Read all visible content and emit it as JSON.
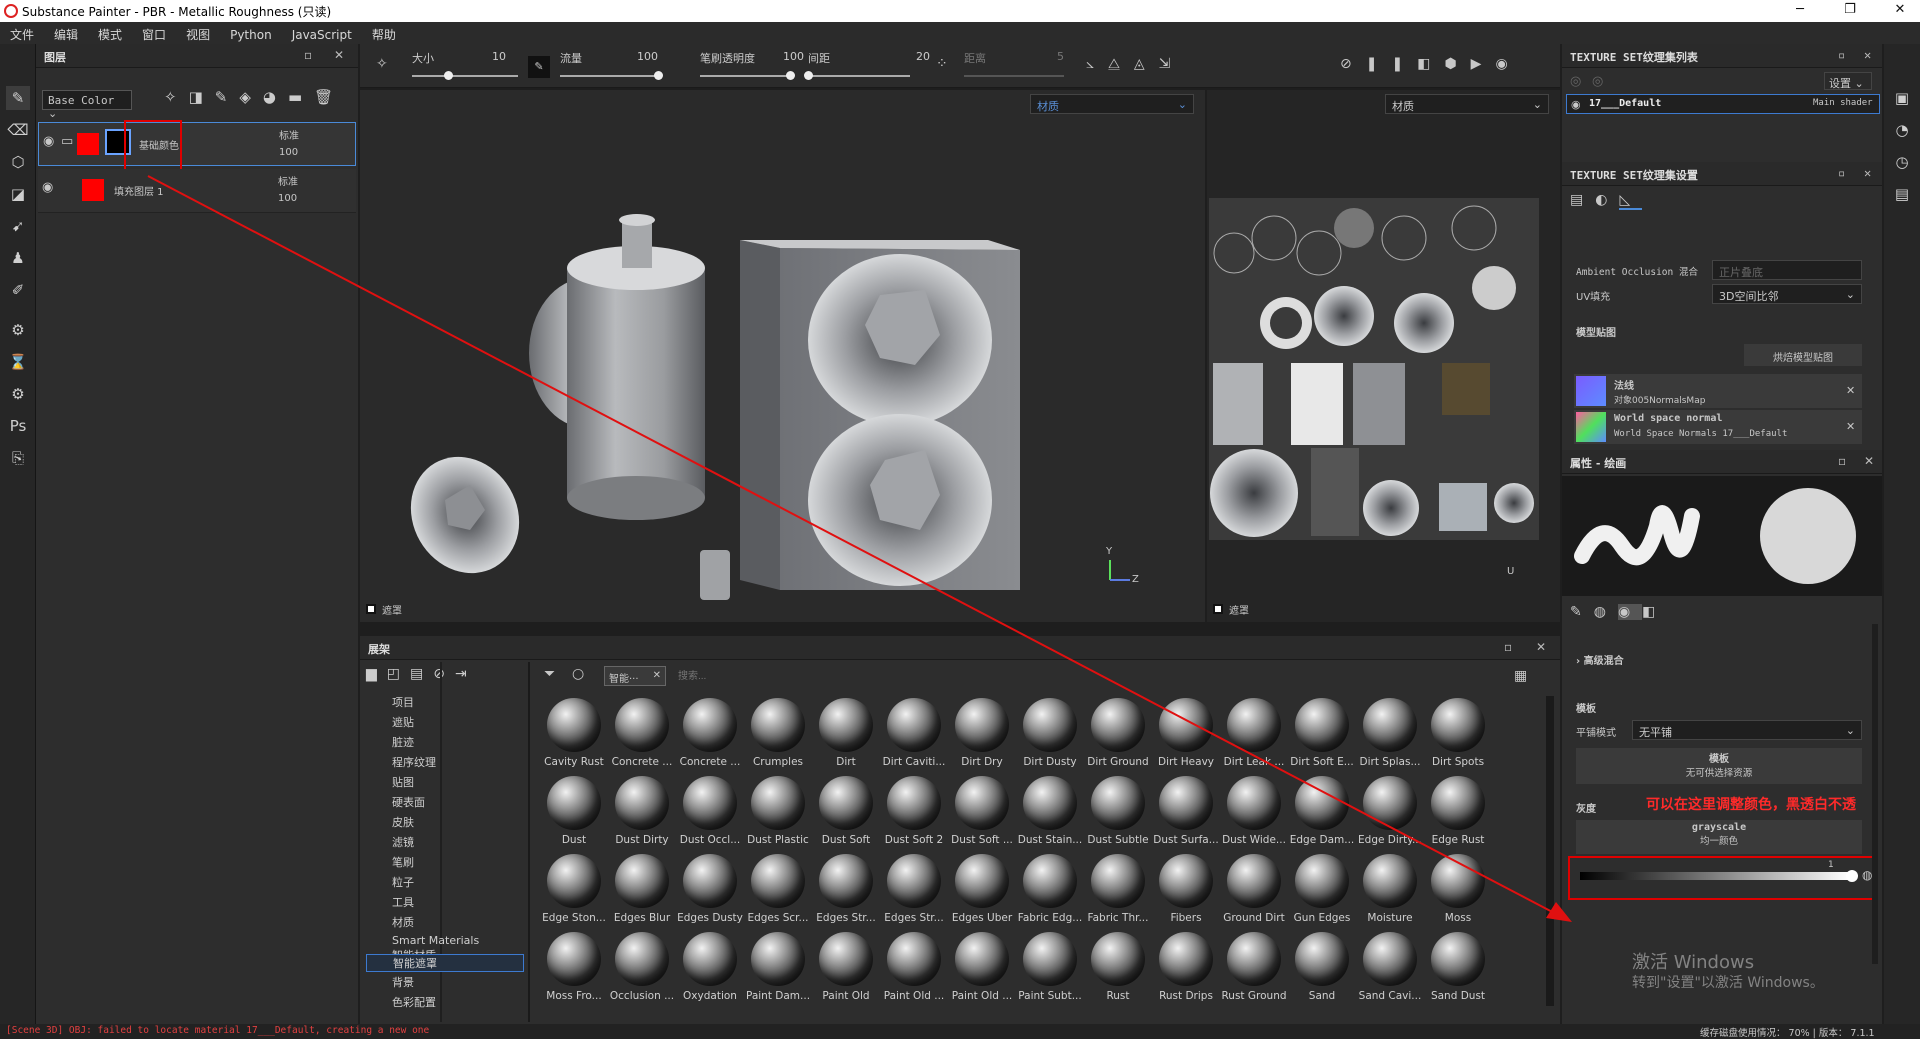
{
  "window": {
    "title": "Substance Painter - PBR - Metallic Roughness (只读)",
    "min": "─",
    "max": "❐",
    "close": "✕"
  },
  "menu": [
    "文件",
    "编辑",
    "模式",
    "窗口",
    "视图",
    "Python",
    "JavaScript",
    "帮助"
  ],
  "layers_panel": {
    "title": "图层",
    "channel": "Base Color",
    "layers": [
      {
        "name": "基础颜色",
        "blend": "标准",
        "opacity": "100"
      },
      {
        "name": "填充图层 1",
        "blend": "标准",
        "opacity": "100"
      }
    ]
  },
  "toolbar": {
    "size_label": "大小",
    "size_value": "10",
    "flow_label": "流量",
    "flow_value": "100",
    "stroke_opacity_label": "笔刷透明度",
    "stroke_opacity_value": "100",
    "spacing_label": "间距",
    "spacing_value": "20",
    "angle_label": "距离",
    "angle_value": "5"
  },
  "viewport": {
    "material_select": "材质",
    "material_select_2d": "材质",
    "mask_label": "遮罩",
    "mask_label_2d": "遮罩",
    "axis_y": "Y",
    "axis_z": "Z",
    "axis_u": "U"
  },
  "shelf": {
    "title": "展架",
    "filter_tag": "智能···",
    "search_placeholder": "搜索...",
    "categories": [
      "项目",
      "遮贴",
      "脏迹",
      "程序纹理",
      "贴图",
      "硬表面",
      "皮肤",
      "滤镜",
      "笔刷",
      "粒子",
      "工具",
      "材质",
      "Smart Materials智能材质",
      "智能遮罩",
      "背景",
      "色彩配置"
    ],
    "selected_category": "智能遮罩",
    "items": [
      "Cavity Rust",
      "Concrete ...",
      "Concrete ...",
      "Crumples",
      "Dirt",
      "Dirt Caviti...",
      "Dirt Dry",
      "Dirt Dusty",
      "Dirt Ground",
      "Dirt Heavy",
      "Dirt Leak ...",
      "Dirt Soft E...",
      "Dirt Splas...",
      "Dirt Spots",
      "Dust",
      "Dust Dirty",
      "Dust Occl...",
      "Dust Plastic",
      "Dust Soft",
      "Dust Soft 2",
      "Dust Soft ...",
      "Dust Stain...",
      "Dust Subtle",
      "Dust Surfa...",
      "Dust Wide...",
      "Edge Dam...",
      "Edge Dirty...",
      "Edge Rust",
      "Edge Ston...",
      "Edges Blur",
      "Edges Dusty",
      "Edges Scr...",
      "Edges Str...",
      "Edges Str...",
      "Edges Uber",
      "Fabric Edg...",
      "Fabric Thr...",
      "Fibers",
      "Ground Dirt",
      "Gun Edges",
      "Moisture",
      "Moss",
      "Moss Fro...",
      "Occlusion ...",
      "Oxydation",
      "Paint Dam...",
      "Paint Old",
      "Paint Old ...",
      "Paint Old ...",
      "Paint Subt...",
      "Rust",
      "Rust Drips",
      "Rust Ground",
      "Sand",
      "Sand Cavi...",
      "Sand Dust"
    ]
  },
  "texture_list": {
    "title": "TEXTURE SET纹理集列表",
    "settings_btn": "设置",
    "item_name": "17___Default",
    "item_shader": "Main shader"
  },
  "texture_settings": {
    "title": "TEXTURE SET纹理集设置",
    "ao_label": "Ambient Occlusion 混合",
    "ao_value": "正片叠底",
    "uv_label": "UV填充",
    "uv_value": "3D空间比邻",
    "mesh_maps_label": "模型贴图",
    "bake_btn": "烘焙模型贴图",
    "maps": [
      {
        "name": "法线",
        "sub": "对象005NormalsMap"
      },
      {
        "name": "World space normal",
        "sub": "World Space Normals 17___Default"
      }
    ]
  },
  "properties": {
    "title": "属性 - 绘画",
    "advanced": "高级混合",
    "stencil_label": "模板",
    "tiling_label": "平铺模式",
    "tiling_value": "无平铺",
    "stencil_btn": "模板",
    "stencil_sub": "无可供选择资源",
    "gray_label": "灰度",
    "annotation": "可以在这里调整颜色，黑透白不透",
    "gray_btn": "grayscale",
    "gray_sub": "均一颜色",
    "gray_value": "1"
  },
  "activation": {
    "line1": "激活 Windows",
    "line2": "转到\"设置\"以激活 Windows。"
  },
  "status": {
    "error": "[Scene 3D] OBJ: failed to locate material 17___Default, creating a new one",
    "disk": "缓存磁盘使用情况：  70%  | 版本：  7.1.1"
  }
}
